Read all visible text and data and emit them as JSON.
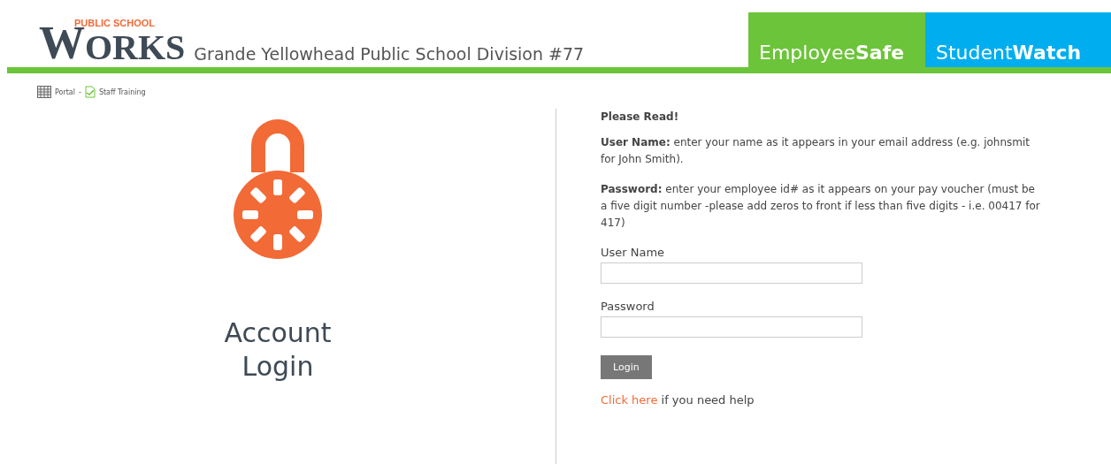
{
  "header": {
    "logo": {
      "initial": "W",
      "rest": "ORKS",
      "tagline": "PUBLIC SCHOOL"
    },
    "title": "Grande Yellowhead Public School Division #77",
    "products": [
      {
        "name": "Employee",
        "bold": "Safe",
        "color": "#6cc43a"
      },
      {
        "name": "Student",
        "bold": "Watch",
        "color": "#00aeef"
      }
    ]
  },
  "breadcrumb": [
    {
      "label": "Portal",
      "kind": "calendar"
    },
    {
      "label": "Staff Training",
      "kind": "document"
    }
  ],
  "breadcrumb_separator": "-",
  "hero": {
    "title_lines": [
      "Account",
      "Login"
    ]
  },
  "instructions": {
    "heading": "Please Read!",
    "paragraphs": [
      "**User Name:** enter your name as it appears in your email address (e.g. johnsmit for John Smith).",
      "**Password:** enter your employee id# as it appears on your pay voucher (must be a five digit number -please add zeros to front if less than five digits - i.e. 00417 for 417)"
    ]
  },
  "form": {
    "fields": [
      {
        "label": "User Name"
      },
      {
        "label": "Password"
      }
    ],
    "submit": "Login",
    "help": {
      "link": "Click here",
      "text": "if you need help"
    }
  }
}
